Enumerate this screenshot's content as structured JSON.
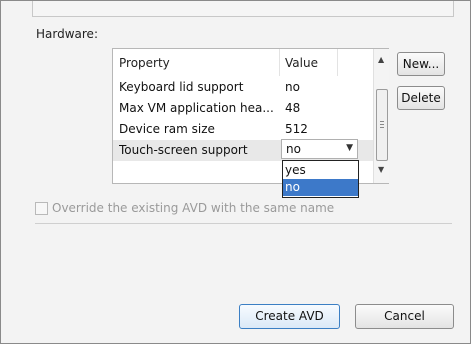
{
  "hardware": {
    "label": "Hardware:",
    "columns": [
      "Property",
      "Value"
    ],
    "rows": [
      {
        "property": "Keyboard lid support",
        "value": "no"
      },
      {
        "property": "Max VM application hea...",
        "value": "48"
      },
      {
        "property": "Device ram size",
        "value": "512"
      },
      {
        "property": "Touch-screen support",
        "value": "no"
      }
    ],
    "dropdown_options": [
      "yes",
      "no"
    ],
    "dropdown_selected": "no",
    "new_button": "New...",
    "delete_button": "Delete"
  },
  "override_checkbox": {
    "label": "Override the existing AVD with the same name",
    "checked": false
  },
  "buttons": {
    "create": "Create AVD",
    "cancel": "Cancel"
  },
  "colors": {
    "selection": "#3d79c9",
    "default_button_border": "#3b7fc4"
  }
}
